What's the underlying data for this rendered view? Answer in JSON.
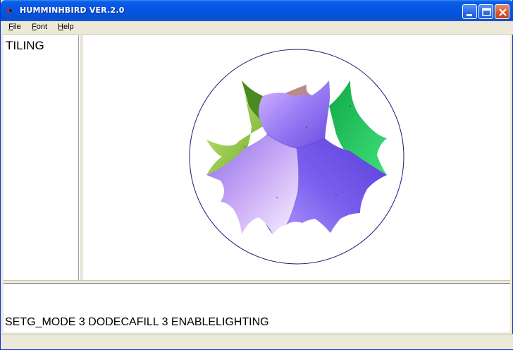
{
  "window": {
    "title": "HUMMINHBIRD VER.2.0"
  },
  "menubar": {
    "items": [
      {
        "accel": "F",
        "rest": "ile"
      },
      {
        "accel": "F",
        "rest": "ont"
      },
      {
        "accel": "H",
        "rest": "elp"
      }
    ]
  },
  "left_panel": {
    "text": "TILING"
  },
  "console": {
    "text": "SETG_MODE 3 DODECAFILL 3 ENABLELIGHTING"
  },
  "colors": {
    "titlebar": "#0556e3",
    "circle": "#1a1a7a",
    "purple": "#7a5cf0",
    "lilac": "#c8a8f5",
    "green": "#22c05a",
    "yellowgreen": "#98d040",
    "mauve": "#b88080",
    "navy": "#2030a0"
  },
  "icons": [
    "app-icon",
    "minimize-icon",
    "maximize-icon",
    "close-icon"
  ]
}
